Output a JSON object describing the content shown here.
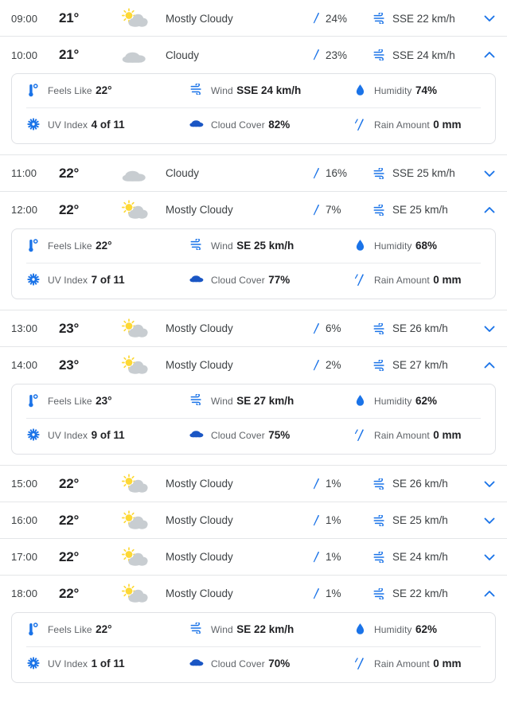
{
  "colors": {
    "accent": "#1a73e8",
    "chevron": "#1a73e8",
    "sun": "#fdd835",
    "cloud_gray": "#c8cdd1",
    "cloud_blue": "#1a56c4",
    "text_primary": "#202124",
    "text_secondary": "#5f6368",
    "rule": "#e4e6e8",
    "card_border": "#dfe1e5",
    "background": "#ffffff"
  },
  "detail_labels": {
    "feels_like": "Feels Like",
    "wind": "Wind",
    "humidity": "Humidity",
    "uv_index": "UV Index",
    "cloud_cover": "Cloud Cover",
    "rain_amount": "Rain Amount"
  },
  "icons": {
    "mostly_cloudy": "sun-behind-cloud-icon",
    "cloudy": "cloud-icon",
    "precipitation": "raindrop-icon",
    "wind": "wind-icon",
    "chevron_down": "chevron-down-icon",
    "chevron_up": "chevron-up-icon",
    "feels_like": "thermometer-icon",
    "humidity": "water-drop-icon",
    "uv_index": "sun-burst-icon",
    "cloud_cover": "filled-cloud-icon",
    "rain_amount": "rain-streaks-icon"
  },
  "hours": [
    {
      "time": "09:00",
      "temp": "21°",
      "condition": "Mostly Cloudy",
      "icon": "mostly_cloudy",
      "precip": "24%",
      "wind": "SSE 22 km/h",
      "expanded": false,
      "details": null
    },
    {
      "time": "10:00",
      "temp": "21°",
      "condition": "Cloudy",
      "icon": "cloudy",
      "precip": "23%",
      "wind": "SSE 24 km/h",
      "expanded": true,
      "details": {
        "feels_like": "22°",
        "wind": "SSE 24 km/h",
        "humidity": "74%",
        "uv_index": "4 of 11",
        "cloud_cover": "82%",
        "rain_amount": "0 mm"
      }
    },
    {
      "time": "11:00",
      "temp": "22°",
      "condition": "Cloudy",
      "icon": "cloudy",
      "precip": "16%",
      "wind": "SSE 25 km/h",
      "expanded": false,
      "details": null
    },
    {
      "time": "12:00",
      "temp": "22°",
      "condition": "Mostly Cloudy",
      "icon": "mostly_cloudy",
      "precip": "7%",
      "wind": "SE 25 km/h",
      "expanded": true,
      "details": {
        "feels_like": "22°",
        "wind": "SE 25 km/h",
        "humidity": "68%",
        "uv_index": "7 of 11",
        "cloud_cover": "77%",
        "rain_amount": "0 mm"
      }
    },
    {
      "time": "13:00",
      "temp": "23°",
      "condition": "Mostly Cloudy",
      "icon": "mostly_cloudy",
      "precip": "6%",
      "wind": "SE 26 km/h",
      "expanded": false,
      "details": null
    },
    {
      "time": "14:00",
      "temp": "23°",
      "condition": "Mostly Cloudy",
      "icon": "mostly_cloudy",
      "precip": "2%",
      "wind": "SE 27 km/h",
      "expanded": true,
      "details": {
        "feels_like": "23°",
        "wind": "SE 27 km/h",
        "humidity": "62%",
        "uv_index": "9 of 11",
        "cloud_cover": "75%",
        "rain_amount": "0 mm"
      }
    },
    {
      "time": "15:00",
      "temp": "22°",
      "condition": "Mostly Cloudy",
      "icon": "mostly_cloudy",
      "precip": "1%",
      "wind": "SE 26 km/h",
      "expanded": false,
      "details": null
    },
    {
      "time": "16:00",
      "temp": "22°",
      "condition": "Mostly Cloudy",
      "icon": "mostly_cloudy",
      "precip": "1%",
      "wind": "SE 25 km/h",
      "expanded": false,
      "details": null
    },
    {
      "time": "17:00",
      "temp": "22°",
      "condition": "Mostly Cloudy",
      "icon": "mostly_cloudy",
      "precip": "1%",
      "wind": "SE 24 km/h",
      "expanded": false,
      "details": null
    },
    {
      "time": "18:00",
      "temp": "22°",
      "condition": "Mostly Cloudy",
      "icon": "mostly_cloudy",
      "precip": "1%",
      "wind": "SE 22 km/h",
      "expanded": true,
      "details": {
        "feels_like": "22°",
        "wind": "SE 22 km/h",
        "humidity": "62%",
        "uv_index": "1 of 11",
        "cloud_cover": "70%",
        "rain_amount": "0 mm"
      }
    }
  ]
}
